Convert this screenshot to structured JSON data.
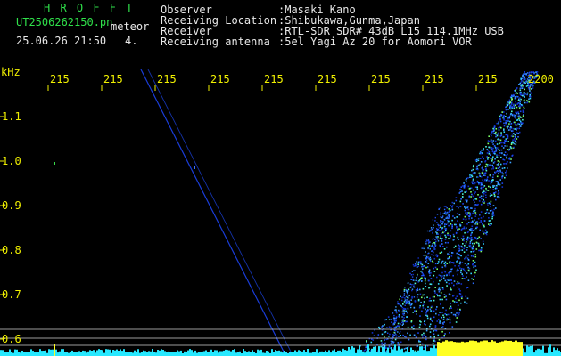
{
  "header": {
    "brand": "H R O F F T",
    "file": "UT2506262150.pn",
    "mode": "meteor",
    "datetime": "25.06.26 21:50",
    "setting": "4.",
    "labels": {
      "observer": "Observer",
      "location": "Receiving Location",
      "receiver": "Receiver",
      "antenna": "Receiving antenna"
    },
    "values": {
      "observer": ":Masaki Kano",
      "location": ":Shibukawa,Gunma,Japan",
      "receiver": ":RTL-SDR SDR# 43dB L15 114.1MHz USB",
      "antenna": ":5el Yagi Az 20 for Aomori VOR"
    }
  },
  "axis": {
    "unit": "kHz",
    "time_labels": [
      "215",
      "215",
      "215",
      "215",
      "215",
      "215",
      "215",
      "215",
      "215",
      "2200"
    ],
    "freq_labels": [
      "1.1",
      "1.0",
      "0.9",
      "0.8",
      "0.7",
      "0.6"
    ]
  },
  "colors": {
    "background": "#000000",
    "header_text": "#2fe04a",
    "info_text": "#e8e8e8",
    "axis_text": "#f0f000",
    "meteor_trace": "#2a6bff",
    "noise_floor": "#27e8ff",
    "carrier_band": "#ffff22"
  }
}
